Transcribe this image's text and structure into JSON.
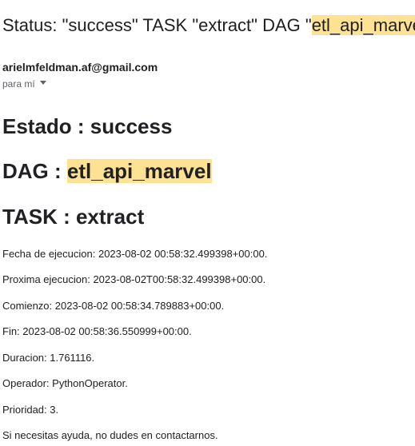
{
  "email": {
    "subject": {
      "prefix": "Status: \"success\" TASK \"extract\" DAG \"",
      "highlight": "etl_api_marvel"
    },
    "sender": "arielmfeldman.af@gmail.com",
    "recipient_label": "para mí"
  },
  "body": {
    "estado_label": "Estado : ",
    "estado_value": "success",
    "dag_label": "DAG : ",
    "dag_value": "etl_api_marvel",
    "task_label": "TASK : ",
    "task_value": "extract",
    "lines": [
      "Fecha de ejecucion: 2023-08-02 00:58:32.499398+00:00.",
      "Proxima ejecucion: 2023-08-02T00:58:32.499398+00:00.",
      "Comienzo: 2023-08-02 00:58:34.789883+00:00.",
      "Fin: 2023-08-02 00:58:36.550999+00:00.",
      "Duracion: 1.761116.",
      "Operador: PythonOperator.",
      "Prioridad: 3.",
      "Si necesitas ayuda, no dudes en contactarnos."
    ]
  },
  "colors": {
    "highlight": "#fde293",
    "text": "#202124",
    "secondary": "#5f6368"
  },
  "icons": {
    "recipient_dropdown": "chevron-down-icon"
  }
}
